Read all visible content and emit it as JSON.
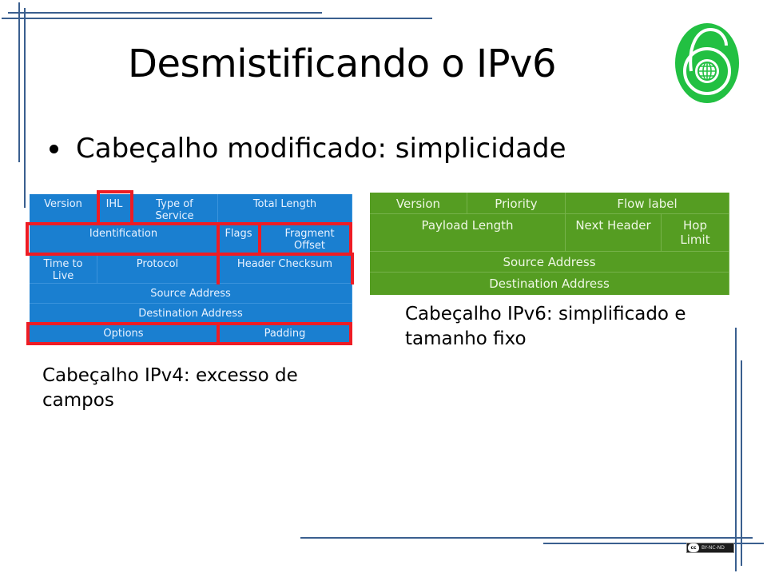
{
  "slide": {
    "title": "Desmistificando o IPv6",
    "bullet": "Cabeçalho modificado: simplicidade",
    "logo_icon": "ipv6-lock-globe-logo",
    "colors": {
      "decor_lines": "#3a5f8f",
      "ipv4_fill": "#1a7fd0",
      "ipv6_fill": "#559d22",
      "highlight": "#ee1c24",
      "logo_green": "#22c042"
    }
  },
  "ipv4_header": {
    "caption": "Cabeçalho IPv4: excesso de campos",
    "fields": {
      "version": "Version",
      "ihl": "IHL",
      "type_of_service": "Type of Service",
      "total_length": "Total Length",
      "identification": "Identification",
      "flags": "Flags",
      "fragment_offset": "Fragment Offset",
      "time_to_live": "Time to Live",
      "protocol": "Protocol",
      "header_checksum": "Header Checksum",
      "source_address": "Source Address",
      "destination_address": "Destination Address",
      "options": "Options",
      "padding": "Padding"
    },
    "highlighted_fields": [
      "IHL",
      "Identification",
      "Flags",
      "Fragment Offset",
      "Header Checksum",
      "Options",
      "Padding"
    ]
  },
  "ipv6_header": {
    "caption": "Cabeçalho IPv6: simplificado e tamanho fixo",
    "fields": {
      "version": "Version",
      "priority": "Priority",
      "flow_label": "Flow label",
      "payload_length": "Payload Length",
      "next_header": "Next Header",
      "hop_limit": "Hop Limit",
      "source_address": "Source Address",
      "destination_address": "Destination Address"
    }
  },
  "license": {
    "icon": "cc-icon",
    "cc": "cc",
    "label": "BY-NC-ND"
  }
}
